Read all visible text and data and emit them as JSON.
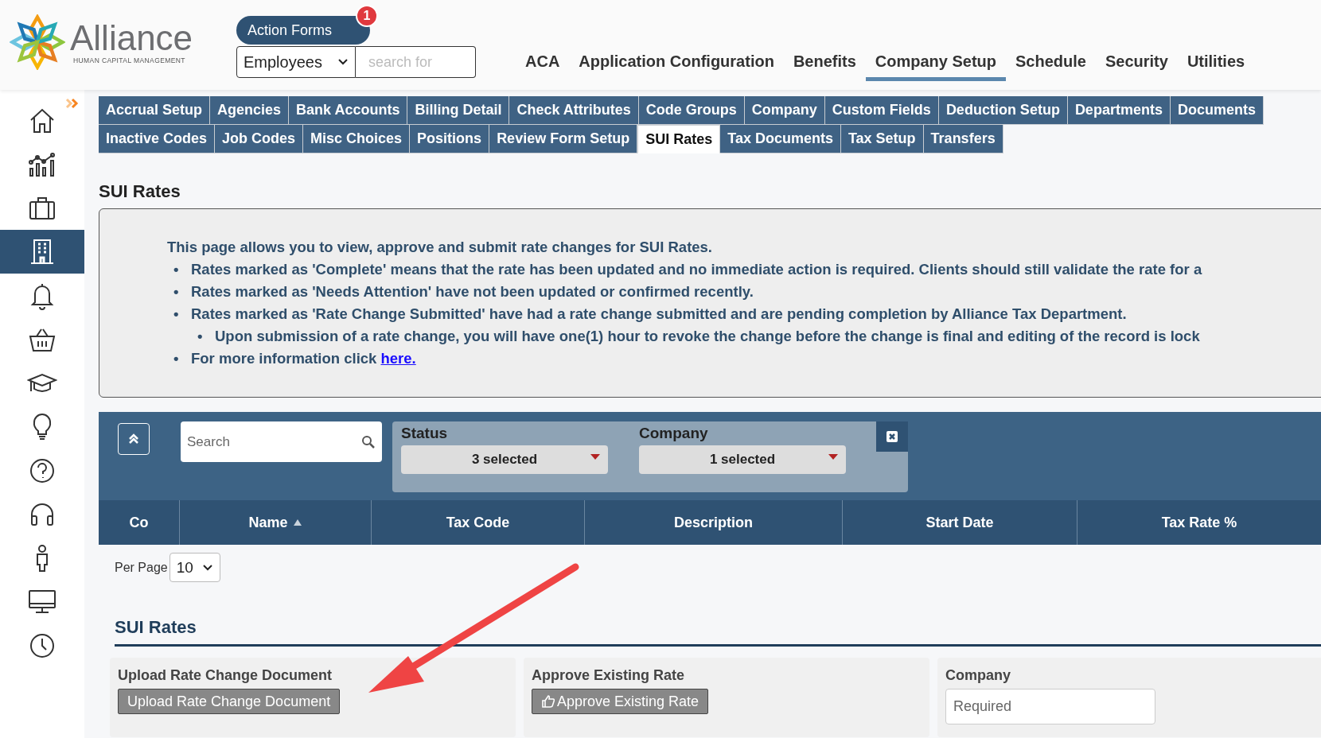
{
  "header": {
    "logo_name": "Alliance",
    "logo_tagline": "HUMAN CAPITAL MANAGEMENT",
    "action_forms": {
      "label": "Action Forms",
      "badge": "1"
    },
    "search_type": "Employees",
    "search": {
      "placeholder": "search for"
    },
    "nav": [
      {
        "label": "ACA",
        "selected": false
      },
      {
        "label": "Application Configuration",
        "selected": false
      },
      {
        "label": "Benefits",
        "selected": false
      },
      {
        "label": "Company Setup",
        "selected": true
      },
      {
        "label": "Schedule",
        "selected": false
      },
      {
        "label": "Security",
        "selected": false
      },
      {
        "label": "Utilities",
        "selected": false
      }
    ]
  },
  "sidebar": {
    "items": [
      {
        "kind": "home",
        "selected": false
      },
      {
        "kind": "chart",
        "selected": false
      },
      {
        "kind": "briefcase",
        "selected": false
      },
      {
        "kind": "building",
        "selected": true
      },
      {
        "kind": "bell",
        "selected": false
      },
      {
        "kind": "basket",
        "selected": false
      },
      {
        "kind": "cap",
        "selected": false
      },
      {
        "kind": "bulb",
        "selected": false
      },
      {
        "kind": "help",
        "selected": false
      },
      {
        "kind": "headphones",
        "selected": false
      },
      {
        "kind": "person",
        "selected": false
      },
      {
        "kind": "monitor",
        "selected": false
      },
      {
        "kind": "clock",
        "selected": false
      }
    ]
  },
  "subtab_rows": [
    {
      "tabs": [
        {
          "label": "Accrual Setup",
          "selected": false
        },
        {
          "label": "Agencies",
          "selected": false
        },
        {
          "label": "Bank Accounts",
          "selected": false
        },
        {
          "label": "Billing Detail",
          "selected": false
        },
        {
          "label": "Check Attributes",
          "selected": false
        },
        {
          "label": "Code Groups",
          "selected": false
        },
        {
          "label": "Company",
          "selected": false
        },
        {
          "label": "Custom Fields",
          "selected": false
        },
        {
          "label": "Deduction Setup",
          "selected": false
        },
        {
          "label": "Departments",
          "selected": false
        },
        {
          "label": "Documents",
          "selected": false
        }
      ]
    },
    {
      "tabs": [
        {
          "label": "Inactive Codes",
          "selected": false
        },
        {
          "label": "Job Codes",
          "selected": false
        },
        {
          "label": "Misc Choices",
          "selected": false
        },
        {
          "label": "Positions",
          "selected": false
        },
        {
          "label": "Review Form Setup",
          "selected": false
        },
        {
          "label": "SUI Rates",
          "selected": true
        },
        {
          "label": "Tax Documents",
          "selected": false
        },
        {
          "label": "Tax Setup",
          "selected": false
        },
        {
          "label": "Transfers",
          "selected": false
        }
      ]
    }
  ],
  "page_title": "SUI Rates",
  "info": {
    "intro": "This page allows you to view, approve and submit rate changes for SUI Rates.",
    "bullets": [
      {
        "marker": "•",
        "text": "Rates marked as 'Complete' means that the rate has been updated and no immediate action is required. Clients should still validate the rate for a"
      },
      {
        "marker": "•",
        "text": "Rates marked as 'Needs Attention' have not been updated or confirmed recently."
      },
      {
        "marker": "•",
        "text": "Rates marked as 'Rate Change Submitted' have had a rate change submitted and are pending completion by Alliance Tax Department.",
        "children": [
          {
            "marker": "•",
            "text": "Upon submission of a rate change, you will have one(1) hour to revoke the change before the change is final and editing of the record is lock"
          }
        ]
      },
      {
        "marker": "•",
        "text": "For more information click ",
        "link": "here."
      }
    ]
  },
  "filters": {
    "search": {
      "placeholder": "Search"
    },
    "dropdowns": [
      {
        "label": "Status",
        "value": "3 selected"
      },
      {
        "label": "Company",
        "value": "1 selected"
      }
    ]
  },
  "table": {
    "columns": [
      {
        "label": "Co",
        "sorted_ascending": false
      },
      {
        "label": "Name",
        "sorted_ascending": true
      },
      {
        "label": "Tax Code",
        "sorted_ascending": false
      },
      {
        "label": "Description",
        "sorted_ascending": false
      },
      {
        "label": "Start Date",
        "sorted_ascending": false
      },
      {
        "label": "Tax Rate %",
        "sorted_ascending": false
      }
    ]
  },
  "per_page": {
    "label": "Per Page",
    "value": "10"
  },
  "section": {
    "title": "SUI Rates",
    "cards": [
      {
        "kind": "button",
        "label": "Upload Rate Change Document",
        "button": "Upload Rate Change Document"
      },
      {
        "kind": "thumb-button",
        "label": "Approve Existing Rate",
        "button": "Approve Existing Rate"
      },
      {
        "kind": "field",
        "label": "Company",
        "placeholder": "Required"
      }
    ]
  }
}
